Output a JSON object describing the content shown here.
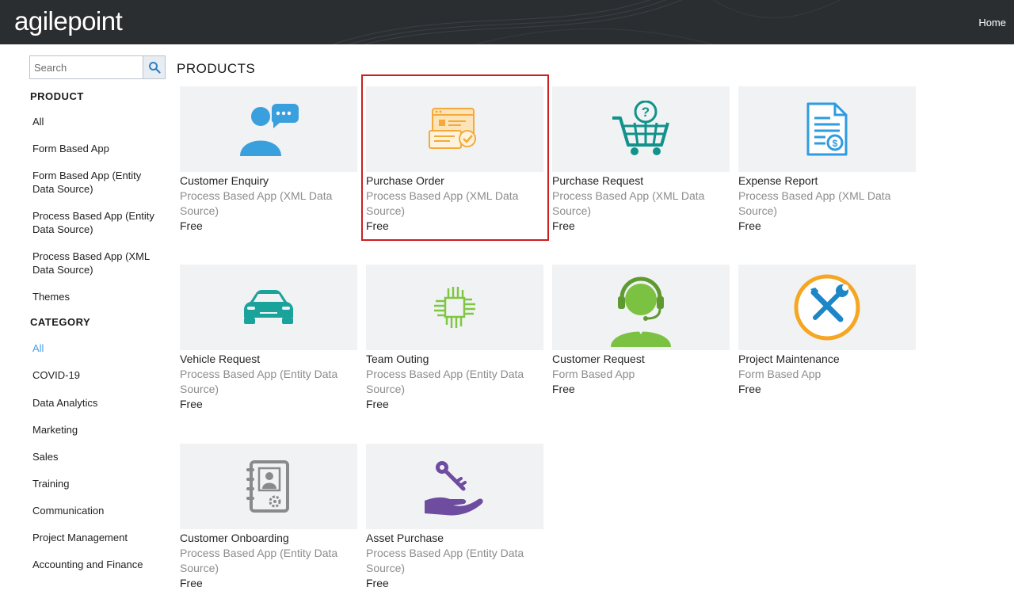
{
  "header": {
    "logo_text": "agilepoint",
    "home_label": "Home"
  },
  "search": {
    "placeholder": "Search",
    "value": ""
  },
  "sidebar": {
    "product_title": "PRODUCT",
    "product_items": [
      {
        "label": "All"
      },
      {
        "label": "Form Based App"
      },
      {
        "label": "Form Based App (Entity Data Source)"
      },
      {
        "label": "Process Based App (Entity Data Source)"
      },
      {
        "label": "Process Based App (XML Data Source)"
      },
      {
        "label": "Themes"
      }
    ],
    "category_title": "CATEGORY",
    "category_items": [
      {
        "label": "All",
        "active": true
      },
      {
        "label": "COVID-19"
      },
      {
        "label": "Data Analytics"
      },
      {
        "label": "Marketing"
      },
      {
        "label": "Sales"
      },
      {
        "label": "Training"
      },
      {
        "label": "Communication"
      },
      {
        "label": "Project Management"
      },
      {
        "label": "Accounting and Finance"
      }
    ]
  },
  "main": {
    "title": "PRODUCTS",
    "highlighted_card": "Purchase Order",
    "products": [
      {
        "name": "Customer Enquiry",
        "type": "Process Based App (XML Data Source)",
        "price": "Free",
        "icon": "customer-enquiry-icon"
      },
      {
        "name": "Purchase Order",
        "type": "Process Based App (XML Data Source)",
        "price": "Free",
        "icon": "purchase-order-icon"
      },
      {
        "name": "Purchase Request",
        "type": "Process Based App (XML Data Source)",
        "price": "Free",
        "icon": "shopping-cart-icon"
      },
      {
        "name": "Expense Report",
        "type": "Process Based App (XML Data Source)",
        "price": "Free",
        "icon": "expense-report-icon"
      },
      {
        "name": "Vehicle Request",
        "type": "Process Based App (Entity Data Source)",
        "price": "Free",
        "icon": "car-icon"
      },
      {
        "name": "Team Outing",
        "type": "Process Based App (Entity Data Source)",
        "price": "Free",
        "icon": "team-hands-icon"
      },
      {
        "name": "Customer Request",
        "type": "Form Based App",
        "price": "Free",
        "icon": "headset-agent-icon"
      },
      {
        "name": "Project Maintenance",
        "type": "Form Based App",
        "price": "Free",
        "icon": "tools-icon"
      },
      {
        "name": "Customer Onboarding",
        "type": "Process Based App (Entity Data Source)",
        "price": "Free",
        "icon": "contact-book-icon"
      },
      {
        "name": "Asset Purchase",
        "type": "Process Based App (Entity Data Source)",
        "price": "Free",
        "icon": "key-hand-icon"
      }
    ]
  },
  "colors": {
    "topbar": "#2b2e31",
    "highlight": "#cc1f1f",
    "active_link": "#4a9be0",
    "muted_text": "#8c8c8c"
  }
}
